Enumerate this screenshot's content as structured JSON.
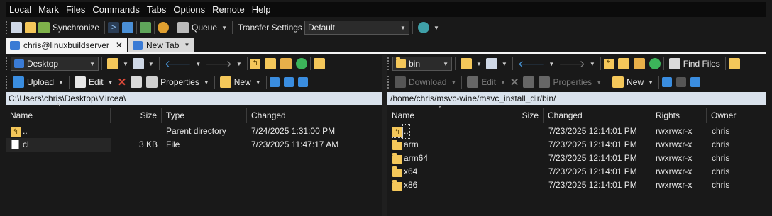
{
  "menu": [
    "Local",
    "Mark",
    "Files",
    "Commands",
    "Tabs",
    "Options",
    "Remote",
    "Help"
  ],
  "toolbar": {
    "synchronize_label": "Synchronize",
    "queue_label": "Queue",
    "transfer_settings_label": "Transfer Settings",
    "transfer_settings_value": "Default"
  },
  "tabs": [
    {
      "label": "chris@linuxbuildserver"
    },
    {
      "label": "New Tab"
    }
  ],
  "left": {
    "drive": "Desktop",
    "upload_label": "Upload",
    "edit_label": "Edit",
    "properties_label": "Properties",
    "new_label": "New",
    "path": "C:\\Users\\chris\\Desktop\\Mircea\\",
    "columns": {
      "name": "Name",
      "size": "Size",
      "type": "Type",
      "changed": "Changed"
    },
    "rows": [
      {
        "icon": "parent-folder-icon",
        "name": "..",
        "size": "",
        "type": "Parent directory",
        "changed": "7/24/2025 1:31:00 PM"
      },
      {
        "icon": "file-icon",
        "name": "cl",
        "size": "3 KB",
        "type": "File",
        "changed": "7/23/2025 11:47:17 AM"
      }
    ]
  },
  "right": {
    "dir": "bin",
    "download_label": "Download",
    "edit_label": "Edit",
    "properties_label": "Properties",
    "new_label": "New",
    "find_files_label": "Find Files",
    "path": "/home/chris/msvc-wine/msvc_install_dir/bin/",
    "columns": {
      "name": "Name",
      "size": "Size",
      "changed": "Changed",
      "rights": "Rights",
      "owner": "Owner"
    },
    "rows": [
      {
        "icon": "parent-folder-icon",
        "name": "..",
        "size": "",
        "changed": "7/23/2025 12:14:01 PM",
        "rights": "rwxrwxr-x",
        "owner": "chris"
      },
      {
        "icon": "folder-icon",
        "name": "arm",
        "size": "",
        "changed": "7/23/2025 12:14:01 PM",
        "rights": "rwxrwxr-x",
        "owner": "chris"
      },
      {
        "icon": "folder-icon",
        "name": "arm64",
        "size": "",
        "changed": "7/23/2025 12:14:01 PM",
        "rights": "rwxrwxr-x",
        "owner": "chris"
      },
      {
        "icon": "folder-icon",
        "name": "x64",
        "size": "",
        "changed": "7/23/2025 12:14:01 PM",
        "rights": "rwxrwxr-x",
        "owner": "chris"
      },
      {
        "icon": "folder-icon",
        "name": "x86",
        "size": "",
        "changed": "7/23/2025 12:14:01 PM",
        "rights": "rwxrwxr-x",
        "owner": "chris"
      }
    ]
  },
  "colors": {
    "folder": "#f4c75a",
    "path_bar": "#d9e2ec",
    "background": "#191919"
  }
}
